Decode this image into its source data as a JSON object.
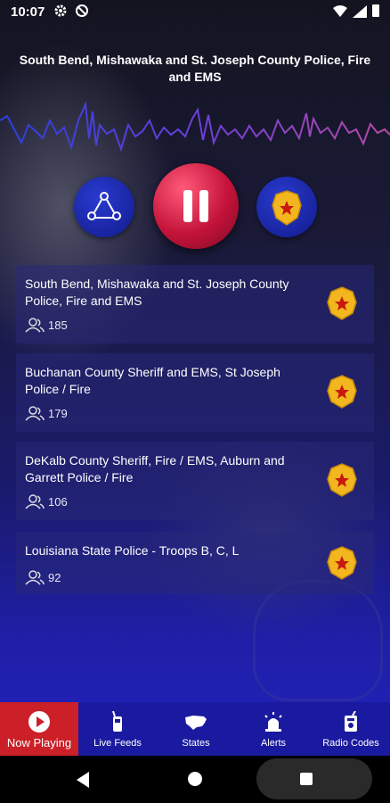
{
  "status_bar": {
    "time": "10:07"
  },
  "header": {
    "title": "South Bend, Mishawaka and St. Joseph County Police, Fire and EMS"
  },
  "colors": {
    "accent_red": "#cc2028",
    "nav_blue": "#1a1aa0",
    "badge_gold": "#f2b61e"
  },
  "feeds": [
    {
      "title": "South Bend, Mishawaka and St. Joseph County Police, Fire and EMS",
      "listeners": "185",
      "icon": "police-badge-icon"
    },
    {
      "title": "Buchanan County Sheriff and EMS, St Joseph Police / Fire",
      "listeners": "179",
      "icon": "police-badge-icon"
    },
    {
      "title": "DeKalb County Sheriff, Fire / EMS, Auburn and Garrett Police / Fire",
      "listeners": "106",
      "icon": "police-badge-icon"
    },
    {
      "title": "Louisiana State Police - Troops B, C, L",
      "listeners": "92",
      "icon": "police-badge-icon"
    }
  ],
  "nav": {
    "tabs": [
      {
        "label": "Now Playing",
        "icon": "play-circle-icon",
        "active": true
      },
      {
        "label": "Live Feeds",
        "icon": "radio-icon",
        "active": false
      },
      {
        "label": "States",
        "icon": "us-map-icon",
        "active": false
      },
      {
        "label": "Alerts",
        "icon": "siren-icon",
        "active": false
      },
      {
        "label": "Radio Codes",
        "icon": "radio-codes-icon",
        "active": false
      }
    ]
  }
}
